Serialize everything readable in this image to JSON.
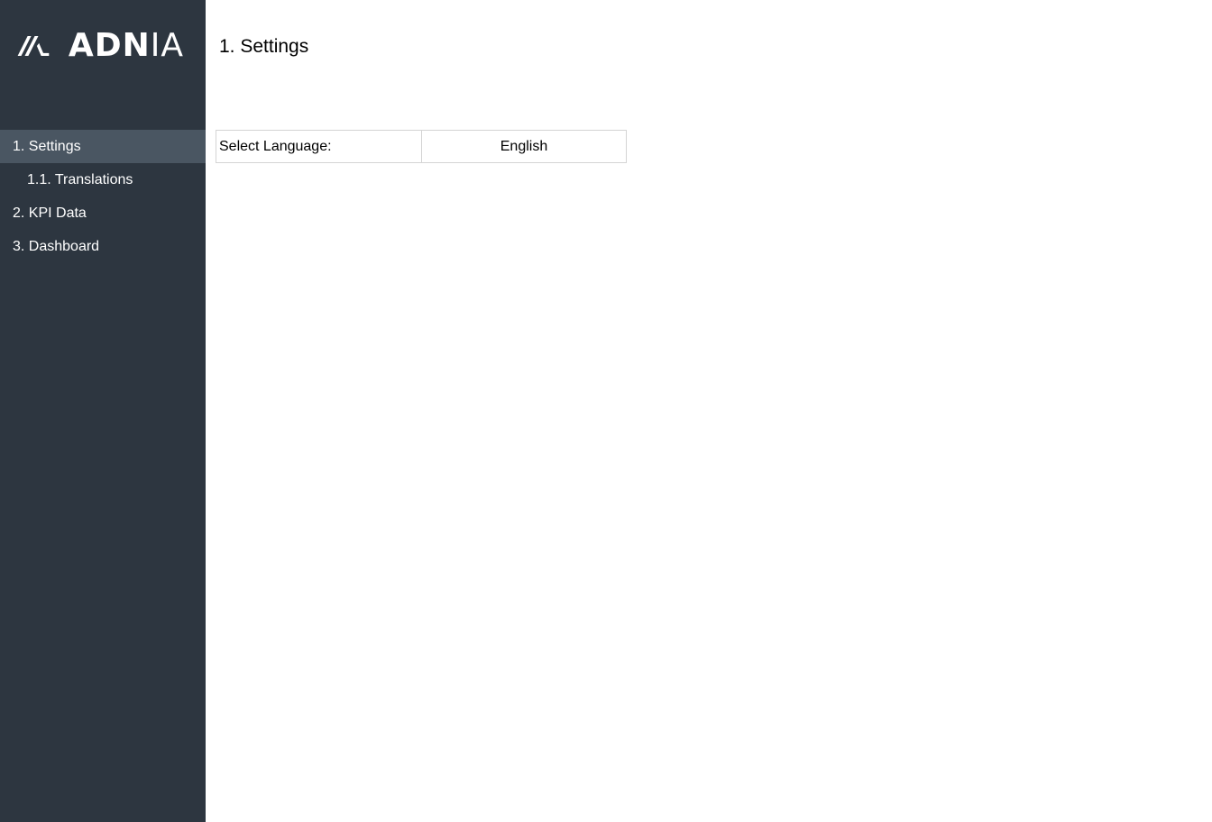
{
  "brand": {
    "logo_text_bold": "ADN",
    "logo_text_thin": "IA",
    "logo_icon": "adnia-logo-icon"
  },
  "sidebar": {
    "items": [
      {
        "label": "1. Settings",
        "active": true,
        "level": 1
      },
      {
        "label": "1.1. Translations",
        "active": false,
        "level": 2
      },
      {
        "label": "2. KPI Data",
        "active": false,
        "level": 1
      },
      {
        "label": "3. Dashboard",
        "active": false,
        "level": 1
      }
    ]
  },
  "main": {
    "title": "1. Settings",
    "language_setting": {
      "label": "Select Language:",
      "value": "English"
    }
  },
  "colors": {
    "sidebar_bg": "#2d3640",
    "sidebar_active_bg": "#4a5662",
    "text_light": "#ffffff",
    "cell_border": "#d4d4d4"
  }
}
